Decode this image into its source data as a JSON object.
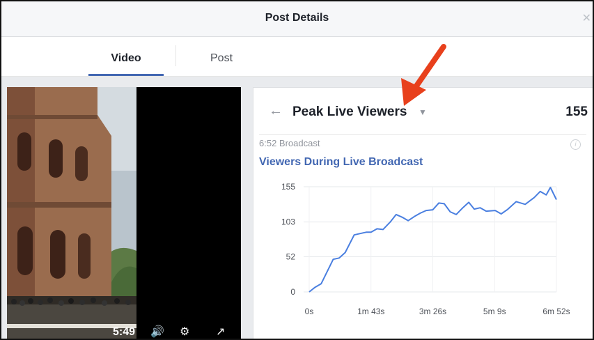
{
  "header": {
    "title": "Post Details",
    "close_icon": "close-icon"
  },
  "tabs": [
    {
      "label": "Video",
      "active": true
    },
    {
      "label": "Post",
      "active": false
    }
  ],
  "video": {
    "time": "5:49",
    "icons": [
      "volume-icon",
      "gear-icon",
      "expand-icon"
    ]
  },
  "panel": {
    "back_icon": "back-arrow-icon",
    "metric_label": "Peak Live Viewers",
    "metric_value": "155",
    "broadcast_label": "6:52 Broadcast",
    "chart_title": "Viewers During Live Broadcast"
  },
  "colors": {
    "accent": "#4267b2",
    "line": "#4a7fe0",
    "annotation": "#e8401c"
  },
  "chart_data": {
    "type": "line",
    "title": "Viewers During Live Broadcast",
    "xlabel": "",
    "ylabel": "",
    "x_tick_labels": [
      "0s",
      "1m 43s",
      "3m 26s",
      "5m 9s",
      "6m 52s"
    ],
    "y_tick_labels": [
      "0",
      "52",
      "103",
      "155"
    ],
    "ylim": [
      0,
      155
    ],
    "xlim": [
      0,
      412
    ],
    "grid": true,
    "series": [
      {
        "x": [
          0,
          10,
          20,
          40,
          50,
          60,
          75,
          85,
          95,
          103,
          113,
          123,
          135,
          145,
          155,
          165,
          175,
          185,
          195,
          206,
          216,
          225,
          235,
          245,
          256,
          266,
          275,
          285,
          295,
          310,
          320,
          330,
          345,
          360,
          375,
          385,
          395,
          402,
          412
        ],
        "y": [
          0,
          7,
          12,
          48,
          50,
          58,
          84,
          86,
          88,
          88,
          93,
          92,
          103,
          114,
          110,
          105,
          111,
          116,
          120,
          121,
          131,
          130,
          118,
          114,
          124,
          132,
          122,
          124,
          119,
          120,
          115,
          121,
          133,
          129,
          139,
          148,
          143,
          154,
          136
        ]
      }
    ]
  }
}
